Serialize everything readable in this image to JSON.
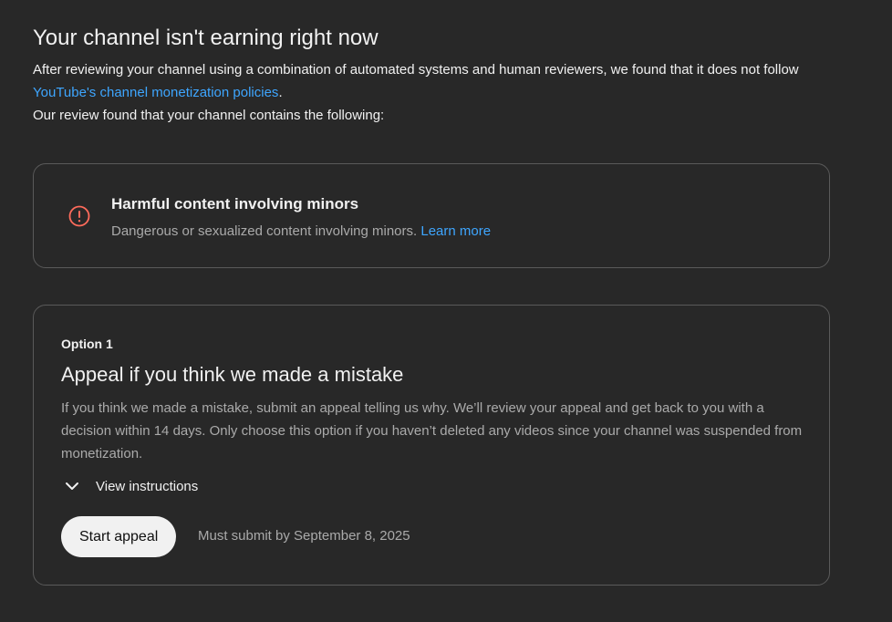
{
  "header": {
    "title": "Your channel isn't earning right now",
    "intro_part1": "After reviewing your channel using a combination of automated systems and human reviewers, we found that it does not follow ",
    "policy_link": "YouTube's channel monetization policies",
    "intro_part2": ".",
    "review_line": "Our review found that your channel contains the following:"
  },
  "violation": {
    "icon": "error-circle-icon",
    "title": "Harmful content involving minors",
    "description": "Dangerous or sexualized content involving minors.",
    "learn_more": "Learn more"
  },
  "option": {
    "label": "Option 1",
    "title": "Appeal if you think we made a mistake",
    "description": "If you think we made a mistake, submit an appeal telling us why. We’ll review your appeal and get back to you with a decision within 14 days. Only choose this option if you haven’t deleted any videos since your channel was suspended from monetization.",
    "instructions_label": "View instructions",
    "button_label": "Start appeal",
    "deadline": "Must submit by September 8, 2025"
  },
  "colors": {
    "background": "#282828",
    "link": "#3ea6ff",
    "error": "#ff6b5b",
    "button_bg": "#f1f1f1"
  }
}
